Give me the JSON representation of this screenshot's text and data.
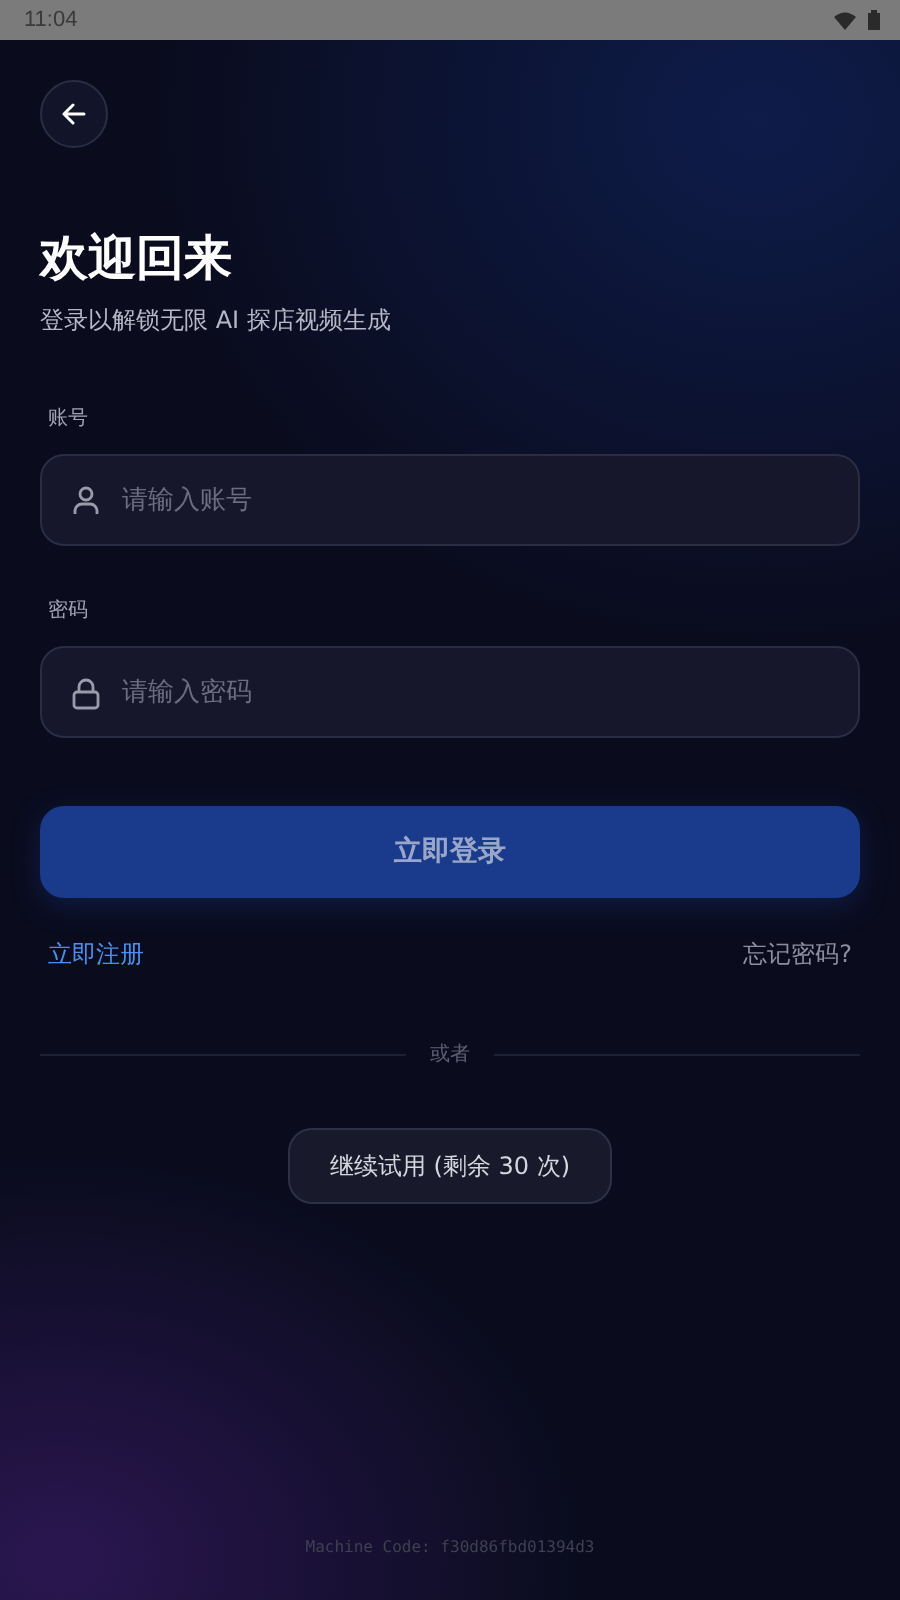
{
  "status_bar": {
    "time": "11:04"
  },
  "title": "欢迎回来",
  "subtitle": "登录以解锁无限 AI 探店视频生成",
  "fields": [
    {
      "kind": "user",
      "label": "账号",
      "placeholder": "请输入账号"
    },
    {
      "kind": "lock",
      "label": "密码",
      "placeholder": "请输入密码"
    }
  ],
  "login_button": "立即登录",
  "register_link": "立即注册",
  "forgot_link": "忘记密码?",
  "divider_text": "或者",
  "trial_button": "继续试用 (剩余 30 次)",
  "machine_code": "Machine Code: f30d86fbd01394d3"
}
